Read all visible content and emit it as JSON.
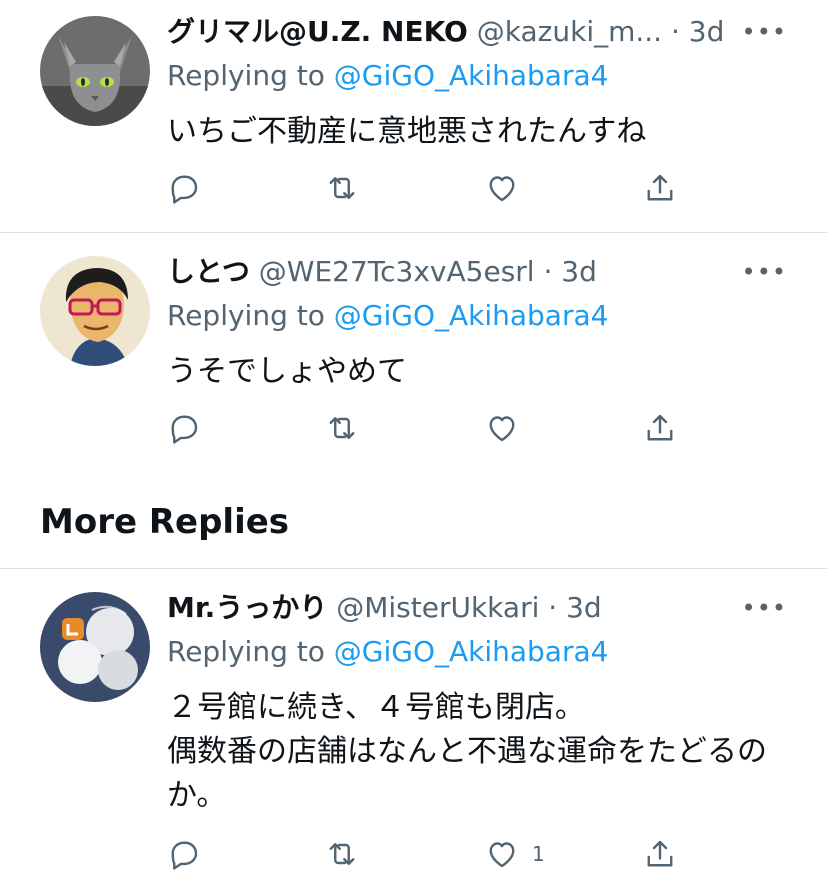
{
  "replies": [
    {
      "name": "グリマル@U.Z. NEKO",
      "handle": "@kazuki_m...",
      "time": "3d",
      "replying_label": "Replying to",
      "replying_to": "@GiGO_Akihabara4",
      "text": "いちご不動産に意地悪されたんすね",
      "like_count": "",
      "avatar_icon": "cat-avatar-icon"
    },
    {
      "name": "しとつ",
      "handle": "@WE27Tc3xvA5esrl",
      "time": "3d",
      "replying_label": "Replying to",
      "replying_to": "@GiGO_Akihabara4",
      "text": "うそでしょやめて",
      "like_count": "",
      "avatar_icon": "anime-face-avatar-icon"
    },
    {
      "name": "Mr.うっかり",
      "handle": "@MisterUkkari",
      "time": "3d",
      "replying_label": "Replying to",
      "replying_to": "@GiGO_Akihabara4",
      "text": "２号館に続き、４号館も閉店。\n偶数番の店舗はなんと不遇な運命をたどるのか。",
      "like_count": "1",
      "avatar_icon": "capsules-avatar-icon"
    }
  ],
  "section": {
    "more_replies": "More Replies"
  },
  "ui": {
    "dot": "·",
    "more": "•••"
  },
  "colors": {
    "link": "#1d9bf0",
    "secondary": "#536471",
    "divider": "#d9dde1"
  }
}
